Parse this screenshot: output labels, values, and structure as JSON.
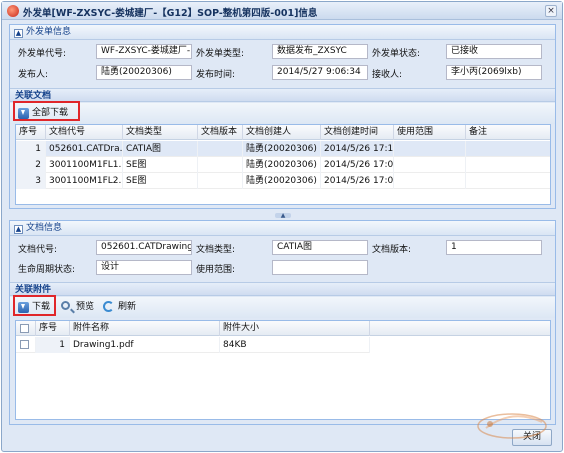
{
  "window": {
    "title": "外发单[WF-ZXSYC-娄城建厂-【G12】SOP-整机第四版-001]信息",
    "close": "×"
  },
  "info_section": {
    "title": "外发单信息",
    "labels": {
      "order_no": "外发单代号:",
      "order_type": "外发单类型:",
      "order_status": "外发单状态:",
      "sender": "发布人:",
      "send_time": "发布时间:",
      "receiver": "接收人:"
    },
    "values": {
      "order_no": "WF-ZXSYC-娄城建厂-【",
      "order_type": "数据发布_ZXSYC",
      "order_status": "已接收",
      "sender": "陆勇(20020306)",
      "send_time": "2014/5/27 9:06:34",
      "receiver": "李小丙(2069lxb)"
    }
  },
  "related_docs": {
    "title": "关联文档",
    "download_all": "全部下载",
    "columns": [
      "序号",
      "文档代号",
      "文档类型",
      "文档版本",
      "文档创建人",
      "文档创建时间",
      "使用范围",
      "备注"
    ],
    "rows": [
      {
        "num": "1",
        "code": "052601.CATDra...",
        "type": "CATIA图",
        "version": "",
        "creator": "陆勇(20020306)",
        "time": "2014/5/26 17:1...",
        "scope": "",
        "note": ""
      },
      {
        "num": "2",
        "code": "3001100M1FL1...",
        "type": "SE图",
        "version": "",
        "creator": "陆勇(20020306)",
        "time": "2014/5/26 17:0...",
        "scope": "",
        "note": ""
      },
      {
        "num": "3",
        "code": "3001100M1FL2...",
        "type": "SE图",
        "version": "",
        "creator": "陆勇(20020306)",
        "time": "2014/5/26 17:0...",
        "scope": "",
        "note": ""
      }
    ]
  },
  "doc_info": {
    "title": "文档信息",
    "labels": {
      "doc_code": "文档代号:",
      "doc_type": "文档类型:",
      "doc_version": "文档版本:",
      "lifecycle": "生命周期状态:",
      "scope": "使用范围:"
    },
    "values": {
      "doc_code": "052601.CATDrawing",
      "doc_type": "CATIA图",
      "doc_version": "1",
      "lifecycle": "设计",
      "scope": ""
    }
  },
  "attachments": {
    "title": "关联附件",
    "toolbar": {
      "download": "下载",
      "preview": "预览",
      "refresh": "刷新"
    },
    "columns": [
      "序号",
      "附件名称",
      "附件大小"
    ],
    "rows": [
      {
        "num": "1",
        "name": "Drawing1.pdf",
        "size": "84KB"
      }
    ]
  },
  "footer": {
    "ok_button": "关闭"
  }
}
